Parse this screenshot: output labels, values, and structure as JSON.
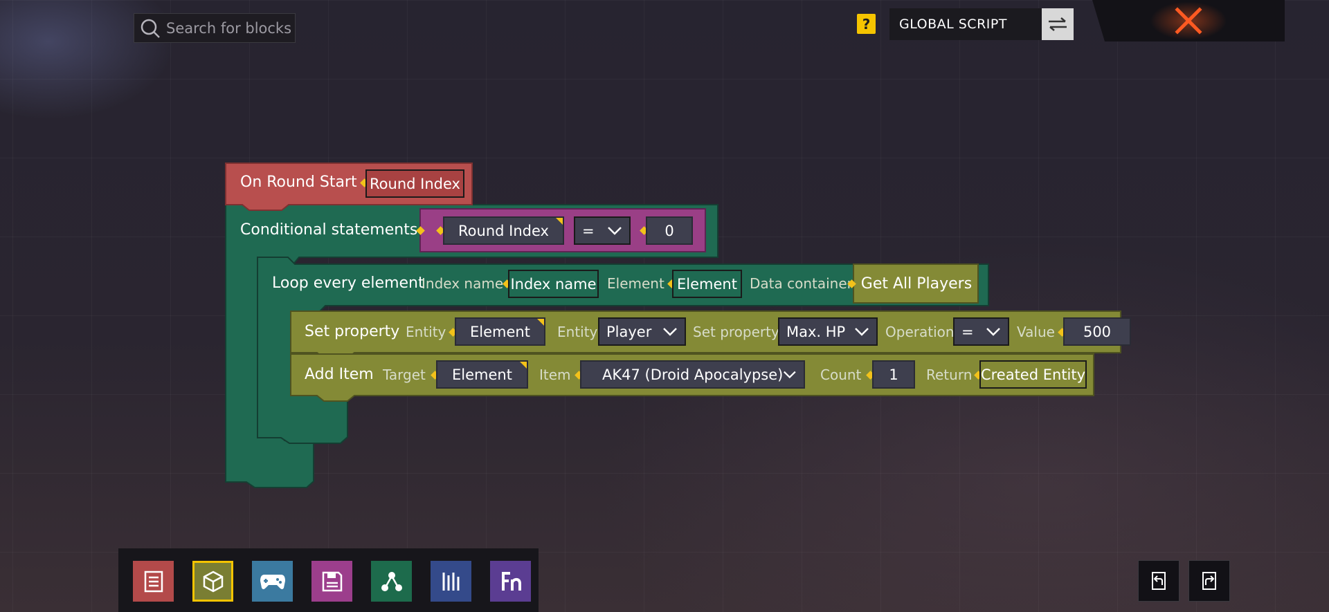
{
  "search": {
    "placeholder": "Search for blocks"
  },
  "header": {
    "help_label": "?",
    "scope_label": "GLOBAL SCRIPT"
  },
  "colors": {
    "event_block": "#b84f4e",
    "control_block": "#1f6a52",
    "action_block": "#848a36",
    "condition_block": "#9a3f86",
    "close_icon": "#ff5a22",
    "help_badge": "#f5c400"
  },
  "canvas": {
    "event": {
      "title": "On Round Start",
      "param": "Round Index"
    },
    "conditional": {
      "title": "Conditional statements",
      "left": "Round Index",
      "operator": "=",
      "right": "0"
    },
    "loop": {
      "title": "Loop every element",
      "index_label": "Index name",
      "index_value": "Index name",
      "element_label": "Element",
      "element_value": "Element",
      "container_label": "Data container",
      "container_value": "Get All Players"
    },
    "set_property": {
      "title": "Set property",
      "entity_label": "Entity",
      "entity_value": "Element",
      "entity_type_label": "Entity",
      "entity_type_value": "Player",
      "property_label": "Set property",
      "property_value": "Max. HP",
      "operation_label": "Operation",
      "operation_value": "=",
      "value_label": "Value",
      "value_value": "500"
    },
    "add_item": {
      "title": "Add Item",
      "target_label": "Target",
      "target_value": "Element",
      "item_label": "Item",
      "item_value": "AK47 (Droid Apocalypse)",
      "count_label": "Count",
      "count_value": "1",
      "return_label": "Return",
      "return_value": "Created Entity"
    }
  },
  "toolbar": {
    "categories": [
      {
        "icon": "document-icon",
        "color": "#b34a4a"
      },
      {
        "icon": "cube-icon",
        "color": "#7a7e33",
        "selected": true
      },
      {
        "icon": "gamepad-icon",
        "color": "#3b7aa0"
      },
      {
        "icon": "save-icon",
        "color": "#9c3e8c"
      },
      {
        "icon": "nodes-icon",
        "color": "#1d6b4c"
      },
      {
        "icon": "bars-icon",
        "color": "#344a8a"
      },
      {
        "icon": "function-icon",
        "color": "#5b3d92"
      }
    ]
  }
}
